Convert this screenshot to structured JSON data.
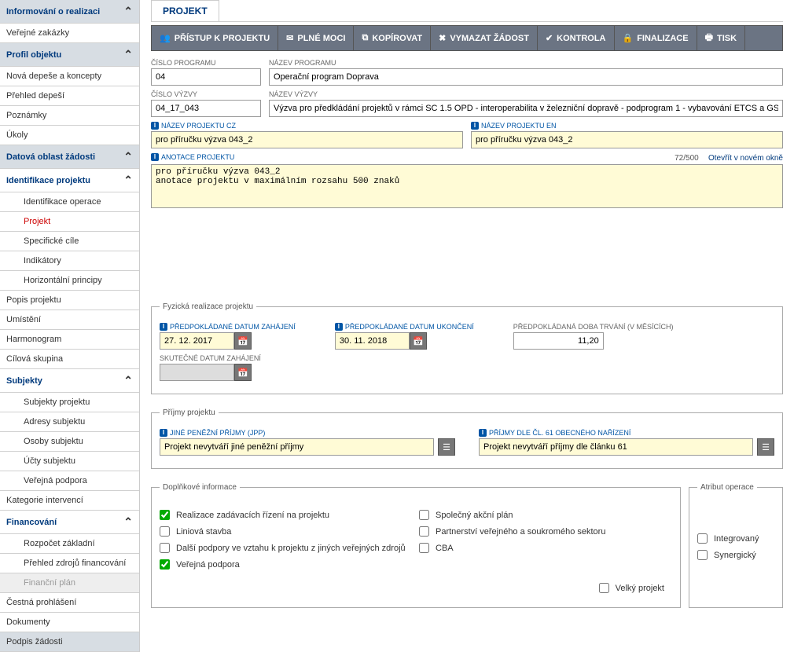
{
  "sidebar": {
    "s0": "Informování o realizaci",
    "s1": "Veřejné zakázky",
    "s2": "Profil objektu",
    "s3": "Nová depeše a koncepty",
    "s4": "Přehled depeší",
    "s5": "Poznámky",
    "s6": "Úkoly",
    "s7": "Datová oblast žádosti",
    "s8": "Identifikace projektu",
    "s9": "Identifikace operace",
    "s10": "Projekt",
    "s11": "Specifické cíle",
    "s12": "Indikátory",
    "s13": "Horizontální principy",
    "s14": "Popis projektu",
    "s15": "Umístění",
    "s16": "Harmonogram",
    "s17": "Cílová skupina",
    "s18": "Subjekty",
    "s19": "Subjekty projektu",
    "s20": "Adresy subjektu",
    "s21": "Osoby subjektu",
    "s22": "Účty subjektu",
    "s23": "Veřejná podpora",
    "s24": "Kategorie intervencí",
    "s25": "Financování",
    "s26": "Rozpočet základní",
    "s27": "Přehled zdrojů financování",
    "s28": "Finanční plán",
    "s29": "Čestná prohlášení",
    "s30": "Dokumenty",
    "s31": "Podpis žádosti"
  },
  "tab": "PROJEKT",
  "toolbar": {
    "t0": "PŘÍSTUP K PROJEKTU",
    "t1": "PLNÉ MOCI",
    "t2": "KOPÍROVAT",
    "t3": "VYMAZAT ŽÁDOST",
    "t4": "KONTROLA",
    "t5": "FINALIZACE",
    "t6": "TISK"
  },
  "labels": {
    "prog_num": "ČÍSLO PROGRAMU",
    "prog_name": "NÁZEV PROGRAMU",
    "call_num": "ČÍSLO VÝZVY",
    "call_name": "NÁZEV VÝZVY",
    "proj_cz": "NÁZEV PROJEKTU CZ",
    "proj_en": "NÁZEV PROJEKTU EN",
    "anno": "ANOTACE PROJEKTU",
    "phys": "Fyzická realizace projektu",
    "date_start": "PŘEDPOKLÁDANÉ DATUM ZAHÁJENÍ",
    "date_end": "PŘEDPOKLÁDANÉ DATUM UKONČENÍ",
    "duration": "PŘEDPOKLÁDANÁ DOBA TRVÁNÍ (V MĚSÍCÍCH)",
    "real_start": "SKUTEČNÉ DATUM ZAHÁJENÍ",
    "income": "Příjmy projektu",
    "jpp": "JINÉ PENĚŽNÍ PŘÍJMY (JPP)",
    "cl61": "PŘÍJMY DLE ČL. 61 OBECNÉHO NAŘÍZENÍ",
    "supp": "Doplňkové informace",
    "attr": "Atribut operace"
  },
  "values": {
    "prog_num": "04",
    "prog_name": "Operační program Doprava",
    "call_num": "04_17_043",
    "call_name": "Výzva pro předkládání projektů v rámci SC 1.5 OPD - interoperabilita v železniční dopravě - podprogram 1 - vybavování ETCS a GSM-R jednotkami",
    "proj_cz": "pro příručku výzva 043_2",
    "proj_en": "pro příručku výzva 043_2",
    "anno": "pro příručku výzva 043_2\nanotace projektu v maximálním rozsahu 500 znaků",
    "counter": "72/500",
    "open_new": "Otevřít v novém okně",
    "date_start": "27. 12. 2017",
    "date_end": "30. 11. 2018",
    "duration": "11,20",
    "real_start": "",
    "jpp": "Projekt nevytváří jiné peněžní příjmy",
    "cl61": "Projekt nevytváří příjmy dle článku 61"
  },
  "checks": {
    "c1": "Realizace zadávacích řízení na projektu",
    "c2": "Liniová stavba",
    "c3": "Další podpory ve vztahu k projektu z jiných veřejných zdrojů",
    "c4": "Veřejná podpora",
    "c5": "Společný akční plán",
    "c6": "Partnerství veřejného a soukromého sektoru",
    "c7": "CBA",
    "c8": "Velký projekt",
    "a1": "Integrovaný",
    "a2": "Synergický"
  }
}
